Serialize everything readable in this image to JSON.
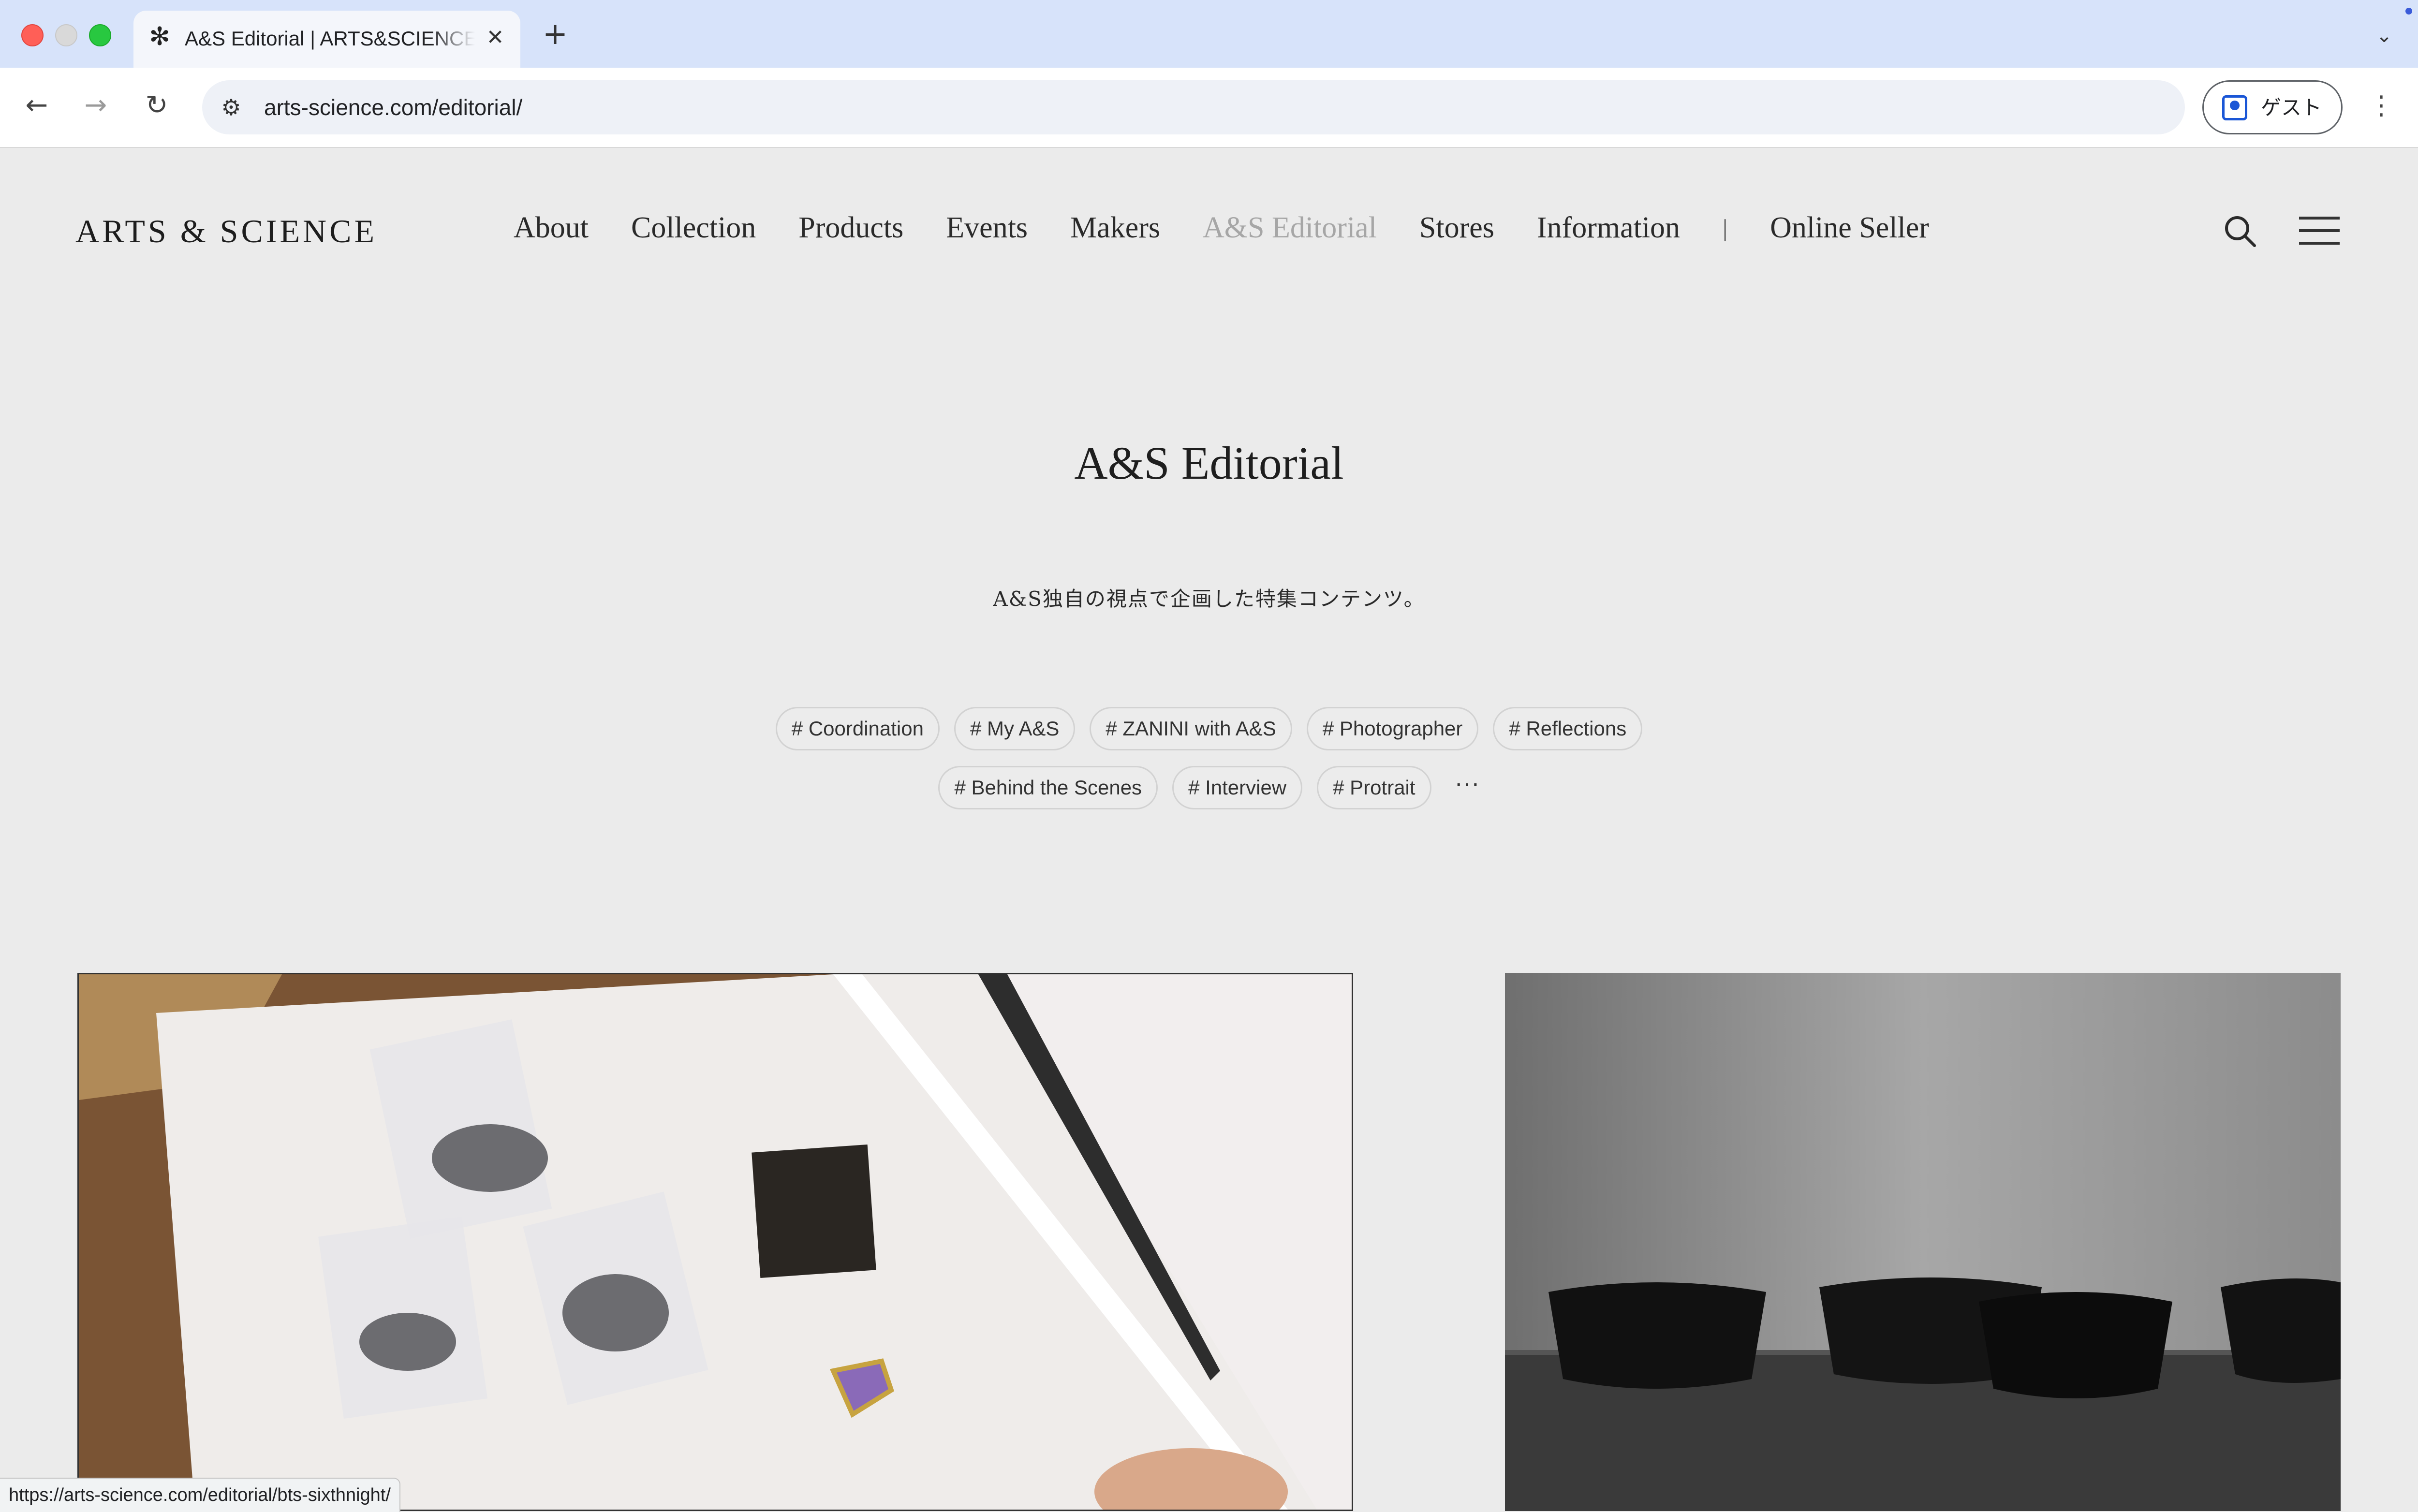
{
  "browser": {
    "tab_title": "A&S Editorial | ARTS&SCIENCE",
    "url": "arts-science.com/editorial/",
    "profile_label": "ゲスト",
    "status_url": "https://arts-science.com/editorial/bts-sixthnight/"
  },
  "site": {
    "logo": "ARTS & SCIENCE",
    "nav": [
      "About",
      "Collection",
      "Products",
      "Events",
      "Makers",
      "A&S Editorial",
      "Stores",
      "Information"
    ],
    "nav_separator": "|",
    "nav_extra": "Online Seller",
    "active_nav": "A&S Editorial"
  },
  "page": {
    "title": "A&S Editorial",
    "lead": "A&S独自の視点で企画した特集コンテンツ。"
  },
  "tags": {
    "row1": [
      "# Coordination",
      "# My A&S",
      "# ZANINI with A&S",
      "# Photographer",
      "# Reflections"
    ],
    "row2": [
      "# Behind the Scenes",
      "# Interview",
      "# Protrait"
    ],
    "more": "···"
  },
  "icons": {
    "favicon": "asterisk-logo-icon",
    "search": "search-icon",
    "menu": "hamburger-menu-icon"
  },
  "colors": {
    "page_bg": "#ebebeb",
    "tabbar_bg": "#d7e3fa",
    "active_nav": "#a6a6a6"
  }
}
